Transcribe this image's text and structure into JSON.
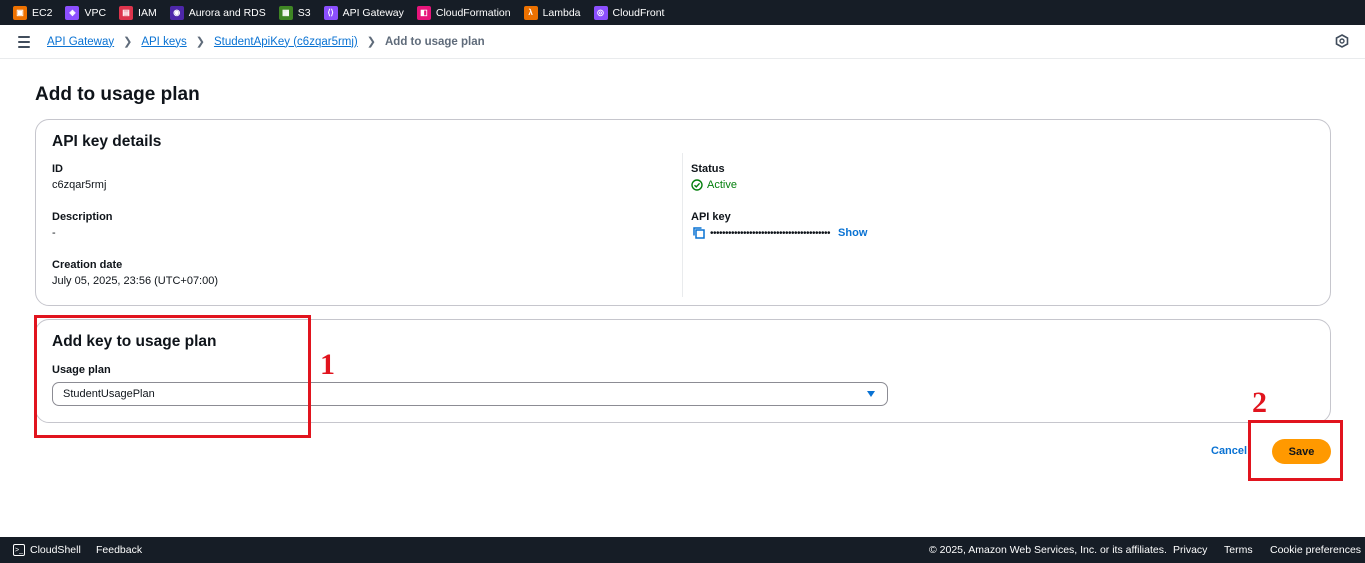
{
  "services": [
    {
      "label": "EC2",
      "color": "#ed7100",
      "icon": "ec2-icon"
    },
    {
      "label": "VPC",
      "color": "#8c4fff",
      "icon": "vpc-icon"
    },
    {
      "label": "IAM",
      "color": "#dd344c",
      "icon": "iam-icon"
    },
    {
      "label": "Aurora and RDS",
      "color": "#4d27aa",
      "icon": "rds-icon"
    },
    {
      "label": "S3",
      "color": "#3f8624",
      "icon": "s3-icon"
    },
    {
      "label": "API Gateway",
      "color": "#8c4fff",
      "icon": "api-gateway-icon"
    },
    {
      "label": "CloudFormation",
      "color": "#e7157b",
      "icon": "cloudformation-icon"
    },
    {
      "label": "Lambda",
      "color": "#ed7100",
      "icon": "lambda-icon"
    },
    {
      "label": "CloudFront",
      "color": "#8c4fff",
      "icon": "cloudfront-icon"
    }
  ],
  "breadcrumb": {
    "items": [
      "API Gateway",
      "API keys",
      "StudentApiKey (c6zqar5rmj)"
    ],
    "current": "Add to usage plan"
  },
  "page": {
    "title": "Add to usage plan"
  },
  "details": {
    "title": "API key details",
    "id_label": "ID",
    "id_value": "c6zqar5rmj",
    "description_label": "Description",
    "description_value": "-",
    "creation_label": "Creation date",
    "creation_value": "July 05, 2025, 23:56 (UTC+07:00)",
    "status_label": "Status",
    "status_value": "Active",
    "apikey_label": "API key",
    "apikey_masked": "••••••••••••••••••••••••••••••••••••••••",
    "show_label": "Show"
  },
  "usage": {
    "title": "Add key to usage plan",
    "field_label": "Usage plan",
    "selected": "StudentUsagePlan"
  },
  "actions": {
    "cancel": "Cancel",
    "save": "Save"
  },
  "annotations": {
    "one": "1",
    "two": "2"
  },
  "footer": {
    "cloudshell": "CloudShell",
    "feedback": "Feedback",
    "copyright": "© 2025, Amazon Web Services, Inc. or its affiliates.",
    "privacy": "Privacy",
    "terms": "Terms",
    "cookies": "Cookie preferences"
  },
  "colors": {
    "accent": "#0972d3",
    "primary_button": "#ff9900",
    "success": "#037f0c",
    "annotation": "#e1141e"
  }
}
